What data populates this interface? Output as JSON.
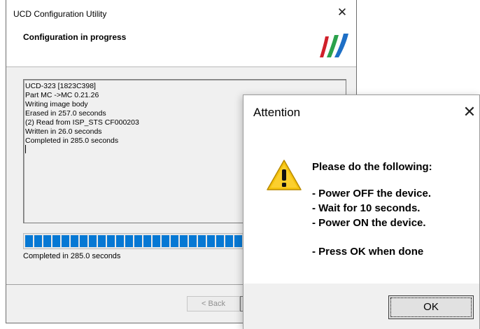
{
  "main_window": {
    "title": "UCD Configuration Utility",
    "close_glyph": "✕",
    "heading": "Configuration in progress",
    "log_lines": [
      "UCD-323 [1823C398]",
      "Part MC ->MC 0.21.26",
      "Writing image body",
      "Erased in 257.0 seconds",
      "(2) Read from ISP_STS CF000203",
      "Written in 26.0 seconds",
      "Completed in 285.0 seconds"
    ],
    "progress": {
      "fraction": 1.0,
      "color": "#0678d4"
    },
    "status": "Completed in 285.0 seconds",
    "back_button": "< Back"
  },
  "dialog": {
    "title": "Attention",
    "close_glyph": "✕",
    "icon": "warning-icon",
    "lines": [
      "Please do the following:",
      "- Power OFF the device.",
      "- Wait for 10 seconds.",
      "- Power ON the device.",
      "- Press OK when done"
    ],
    "ok_button": "OK"
  },
  "colors": {
    "logo": [
      "#d0202a",
      "#2ba24c",
      "#1e6fc6"
    ],
    "warning_fill": "#f5c30d"
  }
}
